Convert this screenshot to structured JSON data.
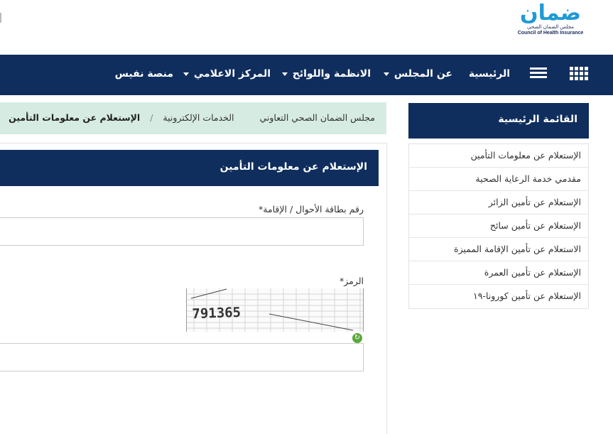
{
  "header": {
    "logo_ar": "ضمان",
    "logo_sub": "مجلس الضمان الصحي",
    "logo_en": "Council of Health Insurance"
  },
  "nav": {
    "items": [
      {
        "label": "الرئيسية"
      },
      {
        "label": "عن المجلس"
      },
      {
        "label": "الانظمة واللوائح"
      },
      {
        "label": "المركز الاعلامي"
      },
      {
        "label": "منصة نفيس"
      }
    ]
  },
  "sidebar": {
    "title": "القائمة الرئيسية",
    "items": [
      {
        "label": "الإستعلام عن معلومات التأمين"
      },
      {
        "label": "مقدمي خدمة الرعاية الصحية"
      },
      {
        "label": "الإستعلام عن تأمين الزائر"
      },
      {
        "label": "الإستعلام عن تأمين سائح"
      },
      {
        "label": "الاستعلام عن تأمين الإقامة المميزة"
      },
      {
        "label": "الإستعلام عن تأمين العمرة"
      },
      {
        "label": "الإستعلام عن تأمين كورونا-١٩"
      }
    ]
  },
  "breadcrumb": {
    "items": [
      "مجلس الضمان الصحي التعاوني",
      "الخدمات الإلكترونية"
    ],
    "separator": "/",
    "current": "الإستعلام عن معلومات التأمين"
  },
  "form": {
    "title": "الإستعلام عن معلومات التأمين",
    "id_label": "رقم بطاقة الأحوال / الإقامة*",
    "id_value": "",
    "captcha_label": "الرمز*",
    "captcha_text": "791365",
    "captcha_value": ""
  },
  "colors": {
    "navy": "#0f2e5d",
    "breadcrumb_bg": "#d6ece3",
    "logo_blue": "#1f9ad6",
    "logo_green": "#35b37a"
  }
}
